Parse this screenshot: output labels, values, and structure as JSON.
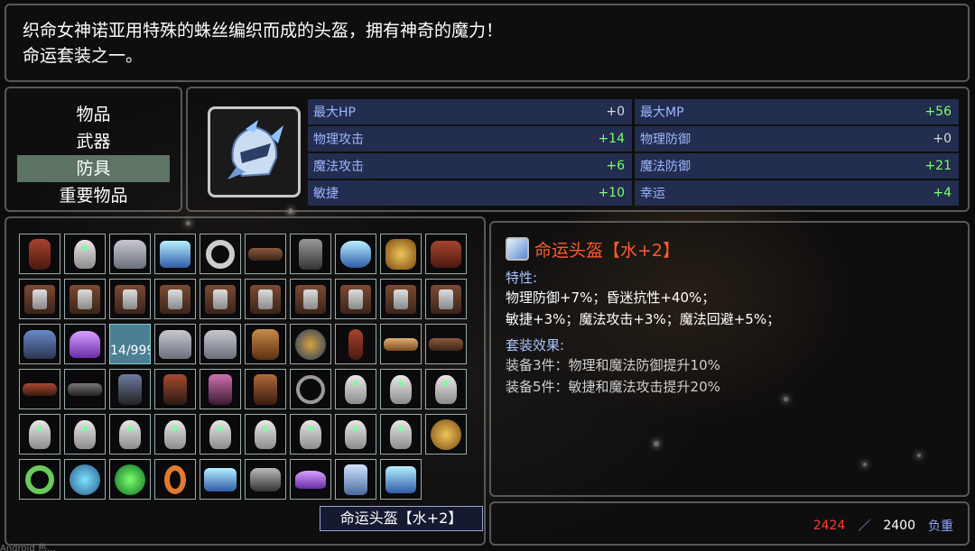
{
  "description": {
    "line1": "织命女神诺亚用特殊的蛛丝编织而成的头盔，拥有神奇的魔力！",
    "line2": "命运套装之一。"
  },
  "categories": [
    {
      "label": "物品"
    },
    {
      "label": "武器"
    },
    {
      "label": "防具"
    },
    {
      "label": "重要物品"
    }
  ],
  "stats": [
    {
      "label": "最大HP",
      "value": "+0"
    },
    {
      "label": "最大MP",
      "value": "+56"
    },
    {
      "label": "物理攻击",
      "value": "+14"
    },
    {
      "label": "物理防御",
      "value": "+0"
    },
    {
      "label": "魔法攻击",
      "value": "+6"
    },
    {
      "label": "魔法防御",
      "value": "+21"
    },
    {
      "label": "敏捷",
      "value": "+10"
    },
    {
      "label": "幸运",
      "value": "+4"
    }
  ],
  "inventory": {
    "selected_count": "14/999"
  },
  "detail": {
    "name": "命运头盔【水+2】",
    "traits_heading": "特性:",
    "traits_line1": "物理防御+7%；昏迷抗性+40%；",
    "traits_line2": "敏捷+3%；魔法攻击+3%；魔法回避+5%；",
    "set_heading": "套装效果:",
    "set_line1": "装备3件：物理和魔法防御提升10%",
    "set_line2": "装备5件：敏捷和魔法攻击提升20%"
  },
  "weight": {
    "current": "2424",
    "separator": "／",
    "max": "2400",
    "label": "负重"
  },
  "tooltip": "命运头盔【水+2】",
  "status_bar": "Android 热…",
  "colors": {
    "positive": "#7dff6a",
    "name": "#ff5a2e",
    "heading": "#a8c4ff",
    "overweight": "#ff3b2e"
  }
}
